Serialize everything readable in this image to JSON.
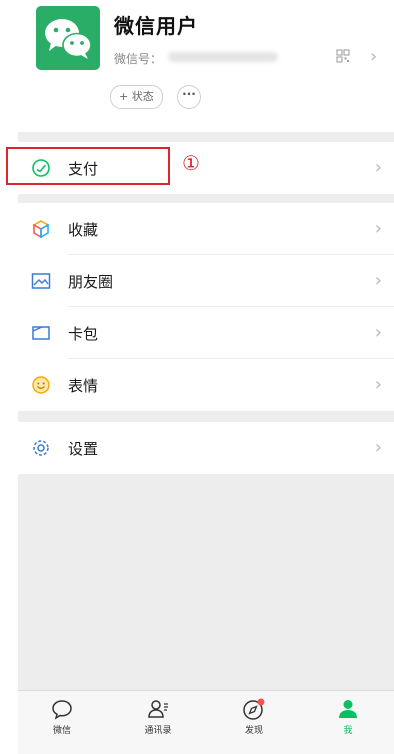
{
  "profile": {
    "nickname": "微信用户",
    "wxid_label": "微信号：",
    "status_button": "+ 状态",
    "more_button": "···"
  },
  "menu": {
    "pay": "支付",
    "favorites": "收藏",
    "moments": "朋友圈",
    "cards": "卡包",
    "stickers": "表情",
    "settings": "设置"
  },
  "annotation": {
    "number": "①",
    "color": "#e0242e"
  },
  "tabbar": {
    "chats": "微信",
    "contacts": "通讯录",
    "discover": "发现",
    "me": "我"
  },
  "colors": {
    "accent": "#07c160",
    "avatar_bg": "#2aae67",
    "badge": "#fa5151"
  },
  "chevron": "›"
}
